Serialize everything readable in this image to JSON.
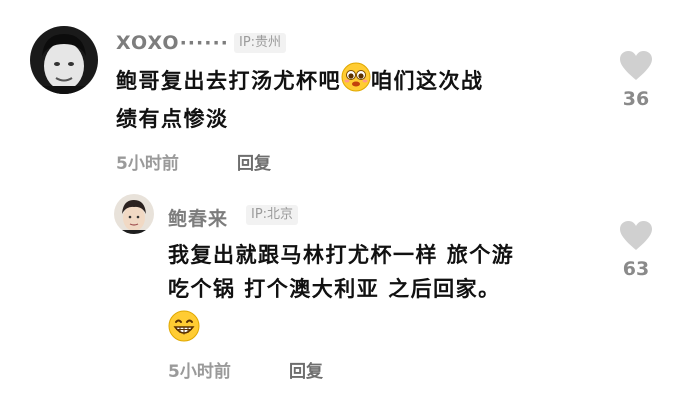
{
  "comment": {
    "username": "XOXO······",
    "ip": "IP:贵州",
    "text_part1": "鲍哥复出去打汤尤杯吧",
    "text_part2": "咱们这次战",
    "text_line2": "绩有点惨淡",
    "time": "5小时前",
    "reply_label": "回复",
    "likes": "36"
  },
  "reply": {
    "username": "鲍春来",
    "ip": "IP:北京",
    "text_line1": "我复出就跟马林打尤杯一样 旅个游",
    "text_line2": "吃个锅 打个澳大利亚 之后回家。",
    "time": "5小时前",
    "reply_label": "回复",
    "likes": "63"
  },
  "icons": {
    "like": "heart-icon",
    "emoji_1": "pleading-face-emoji",
    "emoji_2": "grinning-face-emoji"
  },
  "colors": {
    "text": "#111111",
    "secondary": "#9a9a9a",
    "heart": "#d0d0d0"
  }
}
